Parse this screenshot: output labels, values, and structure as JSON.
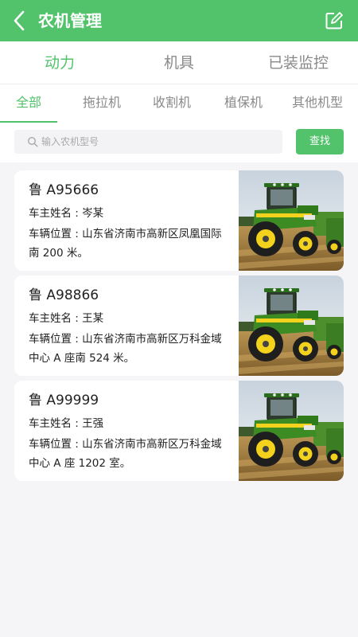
{
  "header": {
    "title": "农机管理",
    "back_icon": "chevron-left-icon",
    "edit_icon": "edit-icon"
  },
  "main_tabs": [
    {
      "label": "动力",
      "active": true
    },
    {
      "label": "机具",
      "active": false
    },
    {
      "label": "已装监控",
      "active": false
    }
  ],
  "sub_tabs": [
    {
      "label": "全部",
      "active": true
    },
    {
      "label": "拖拉机",
      "active": false
    },
    {
      "label": "收割机",
      "active": false
    },
    {
      "label": "植保机",
      "active": false
    },
    {
      "label": "其他机型",
      "active": false
    }
  ],
  "search": {
    "placeholder": "输入农机型号",
    "button_label": "查找"
  },
  "vehicles": [
    {
      "plate": "鲁 A95666",
      "owner": "车主姓名 : 岑某",
      "location": "车辆位置 : 山东省济南市高新区凤凰国际南 200 米。",
      "image": "tractor-photo"
    },
    {
      "plate": "鲁 A98866",
      "owner": "车主姓名 : 王某",
      "location": "车辆位置 : 山东省济南市高新区万科金域中心 A 座南 524 米。",
      "image": "tractor-photo"
    },
    {
      "plate": "鲁 A99999",
      "owner": "车主姓名 : 王强",
      "location": "车辆位置 : 山东省济南市高新区万科金域中心 A 座 1202 室。",
      "image": "tractor-photo"
    }
  ],
  "colors": {
    "accent": "#52c36b",
    "background": "#f5f4f7",
    "inactive_text": "#8a8a8a"
  }
}
